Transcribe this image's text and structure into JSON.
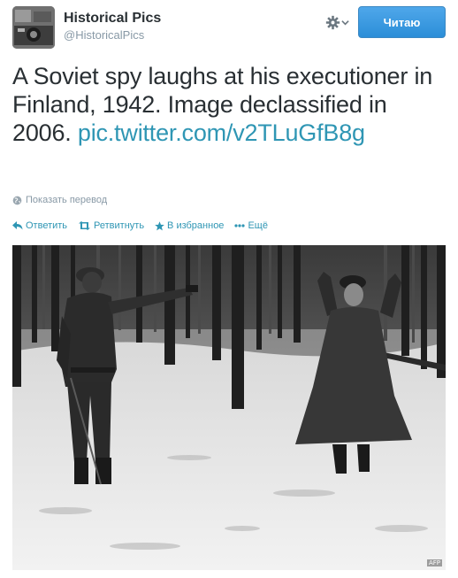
{
  "header": {
    "display_name": "Historical Pics",
    "username": "@HistoricalPics",
    "follow_label": "Читаю"
  },
  "tweet": {
    "text": "A Soviet spy laughs at his executioner in Finland, 1942. Image declassified in 2006.",
    "link": "pic.twitter.com/v2TLuGfB8g",
    "translate_label": "Показать перевод"
  },
  "actions": {
    "reply": "Ответить",
    "retweet": "Ретвитнуть",
    "favorite": "В избранное",
    "more": "Ещё"
  },
  "photo": {
    "credit": "AFP"
  },
  "colors": {
    "link": "#2f96b4",
    "follow_button": "#2b8ed8",
    "muted": "#8899a6"
  },
  "icons": [
    "gear-icon",
    "chevron-down-icon",
    "globe-icon",
    "reply-icon",
    "retweet-icon",
    "star-icon",
    "ellipsis-icon"
  ]
}
